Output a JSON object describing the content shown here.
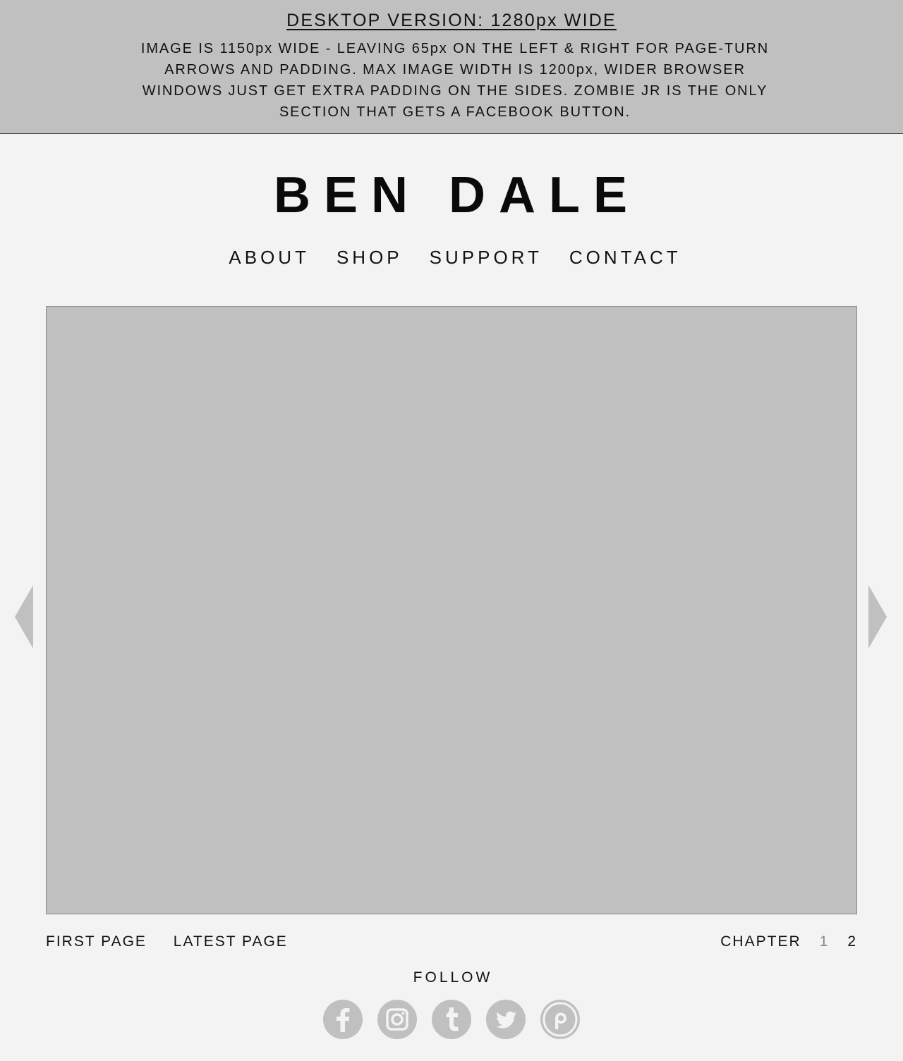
{
  "banner": {
    "title": "DESKTOP VERSION: 1280px WIDE",
    "body": "IMAGE IS 1150px WIDE - LEAVING 65px ON THE LEFT & RIGHT FOR PAGE-TURN ARROWS AND PADDING. MAX IMAGE WIDTH IS 1200px, WIDER BROWSER WINDOWS JUST GET EXTRA PADDING ON THE SIDES. ZOMBIE JR IS THE ONLY SECTION THAT GETS A FACEBOOK BUTTON."
  },
  "logo": "BEN DALE",
  "nav": {
    "items": [
      {
        "label": "ABOUT"
      },
      {
        "label": "SHOP"
      },
      {
        "label": "SUPPORT"
      },
      {
        "label": "CONTACT"
      }
    ]
  },
  "arrows": {
    "prev_icon": "triangle-left-icon",
    "next_icon": "triangle-right-icon",
    "color": "#c0c0c0"
  },
  "pager": {
    "first": "FIRST PAGE",
    "latest": "LATEST PAGE"
  },
  "chapters": {
    "label": "CHAPTER",
    "items": [
      "1",
      "2"
    ],
    "current": "1"
  },
  "follow": {
    "label": "FOLLOW",
    "icons": [
      "facebook-icon",
      "instagram-icon",
      "tumblr-icon",
      "twitter-icon",
      "patreon-icon"
    ]
  },
  "colors": {
    "background": "#f3f3f3",
    "placeholder_gray": "#c0c0c0",
    "text": "#111111",
    "muted": "#888888"
  }
}
